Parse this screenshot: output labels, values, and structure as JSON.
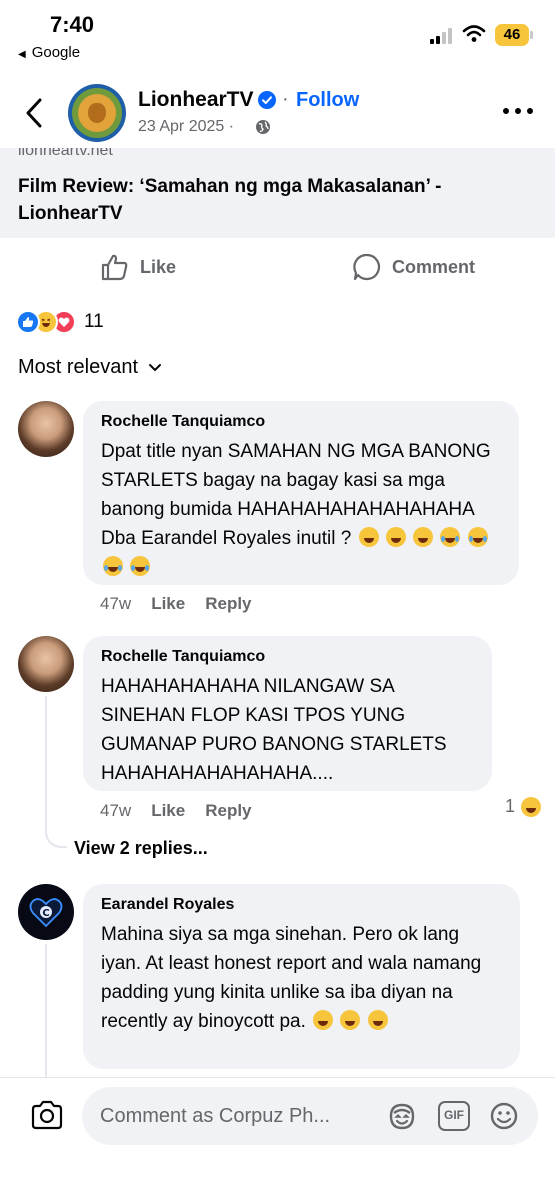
{
  "status": {
    "time": "7:40",
    "back_app": "Google",
    "battery": "46"
  },
  "header": {
    "page_name": "LionhearTV",
    "follow": "Follow",
    "date": "23 Apr 2025",
    "sep": "·",
    "date_sep": "·"
  },
  "link_card": {
    "domain": "lionheartv.net",
    "title": "Film Review: ‘Samahan ng mga Makasalanan’ - LionhearTV"
  },
  "actions": {
    "like": "Like",
    "comment": "Comment"
  },
  "reactions": {
    "count": "11"
  },
  "sort": {
    "label": "Most relevant"
  },
  "comments": [
    {
      "author": "Rochelle Tanquiamco",
      "text": "Dpat title nyan SAMAHAN NG MGA BANONG STARLETS bagay na bagay kasi sa mga banong bumida HAHAHAHAHAHAHAHAHA Dba Earandel Royales inutil ?",
      "time": "47w",
      "like": "Like",
      "reply": "Reply"
    },
    {
      "author": "Rochelle Tanquiamco",
      "text": "HAHAHAHAHAHA NILANGAW SA SINEHAN FLOP KASI TPOS YUNG GUMANAP PURO BANONG STARLETS HAHAHAHAHAHAHAHA....",
      "time": "47w",
      "like": "Like",
      "reply": "Reply",
      "reaction_count": "1"
    },
    {
      "author": "Earandel Royales",
      "text": "Mahina siya sa mga sinehan. Pero ok lang iyan. At least honest report and wala namang padding yung kinita unlike sa iba diyan na recently ay binoycott pa."
    }
  ],
  "view_replies": "View 2 replies...",
  "composer": {
    "placeholder": "Comment as Corpuz Ph..."
  },
  "colors": {
    "accent": "#0866ff",
    "bubble": "#f0f2f5",
    "meta": "#65676b"
  }
}
